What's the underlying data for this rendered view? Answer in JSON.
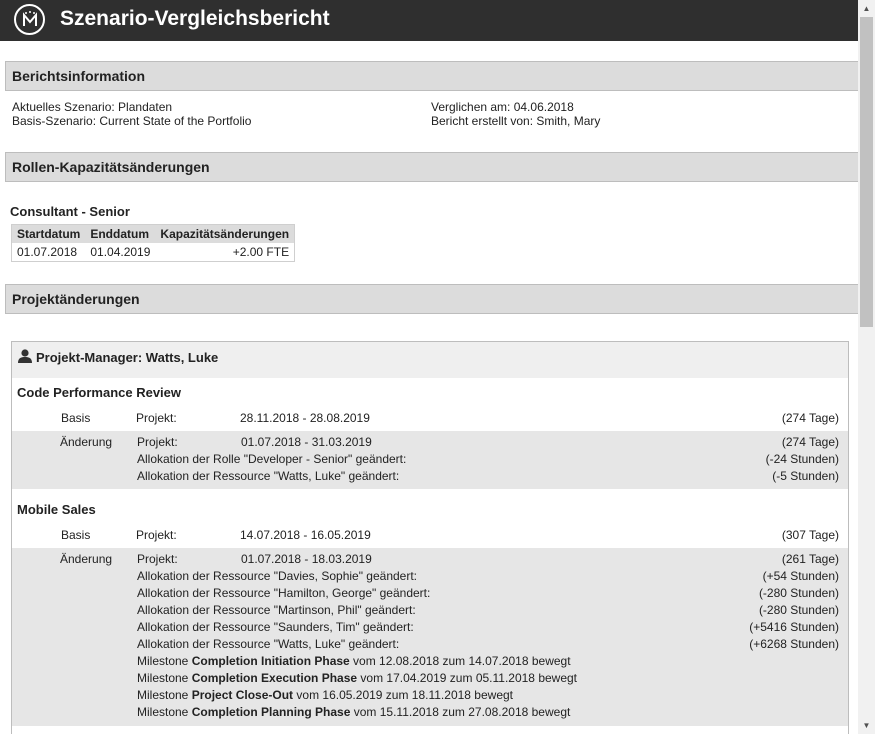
{
  "header": {
    "title": "Szenario-Vergleichsbericht",
    "logo_text": "M"
  },
  "report_info": {
    "heading": "Berichtsinformation",
    "current_scenario": "Aktuelles Szenario: Plandaten",
    "base_scenario": "Basis-Szenario: Current State of the Portfolio",
    "compared_on": "Verglichen am: 04.06.2018",
    "created_by": "Bericht erstellt von: Smith, Mary"
  },
  "role_changes": {
    "heading": "Rollen-Kapazitätsänderungen",
    "role": "Consultant - Senior",
    "columns": [
      "Startdatum",
      "Enddatum",
      "Kapazitätsänderungen"
    ],
    "rows": [
      [
        "01.07.2018",
        "01.04.2019",
        "+2.00 FTE"
      ]
    ]
  },
  "project_changes": {
    "heading": "Projektänderungen",
    "manager": "Projekt-Manager: Watts, Luke",
    "projects": [
      {
        "name": "Code Performance Review",
        "base_label": "Basis",
        "base_project_label": "Projekt:",
        "base_dates": "28.11.2018 - 28.08.2019",
        "base_duration": "(274 Tage)",
        "change_label": "Änderung",
        "change_project_label": "Projekt:",
        "change_dates": "01.07.2018 - 31.03.2019",
        "change_duration": "(274 Tage)",
        "changes": [
          {
            "text": "Allokation der Rolle \"Developer - Senior\" geändert:",
            "value": "(-24 Stunden)"
          },
          {
            "text": "Allokation der Ressource \"Watts, Luke\" geändert:",
            "value": "(-5 Stunden)"
          }
        ]
      },
      {
        "name": "Mobile Sales",
        "base_label": "Basis",
        "base_project_label": "Projekt:",
        "base_dates": "14.07.2018 - 16.05.2019",
        "base_duration": "(307 Tage)",
        "change_label": "Änderung",
        "change_project_label": "Projekt:",
        "change_dates": "01.07.2018 - 18.03.2019",
        "change_duration": "(261 Tage)",
        "changes": [
          {
            "text": "Allokation der Ressource \"Davies, Sophie\" geändert:",
            "value": "(+54 Stunden)"
          },
          {
            "text": "Allokation der Ressource \"Hamilton, George\" geändert:",
            "value": "(-280 Stunden)"
          },
          {
            "text": "Allokation der Ressource \"Martinson, Phil\" geändert:",
            "value": "(-280 Stunden)"
          },
          {
            "text": "Allokation der Ressource \"Saunders, Tim\" geändert:",
            "value": "(+5416 Stunden)"
          },
          {
            "text": "Allokation der Ressource \"Watts, Luke\" geändert:",
            "value": "(+6268 Stunden)"
          }
        ],
        "milestones": [
          {
            "prefix": "Milestone ",
            "name": "Completion Initiation Phase",
            "suffix": " vom 12.08.2018 zum 14.07.2018 bewegt"
          },
          {
            "prefix": "Milestone ",
            "name": "Completion Execution Phase",
            "suffix": " vom 17.04.2019 zum 05.11.2018 bewegt"
          },
          {
            "prefix": "Milestone ",
            "name": "Project Close-Out",
            "suffix": " vom 16.05.2019 zum 18.11.2018 bewegt"
          },
          {
            "prefix": "Milestone ",
            "name": "Completion Planning Phase",
            "suffix": " vom 15.11.2018 zum 27.08.2018 bewegt"
          }
        ]
      }
    ]
  }
}
